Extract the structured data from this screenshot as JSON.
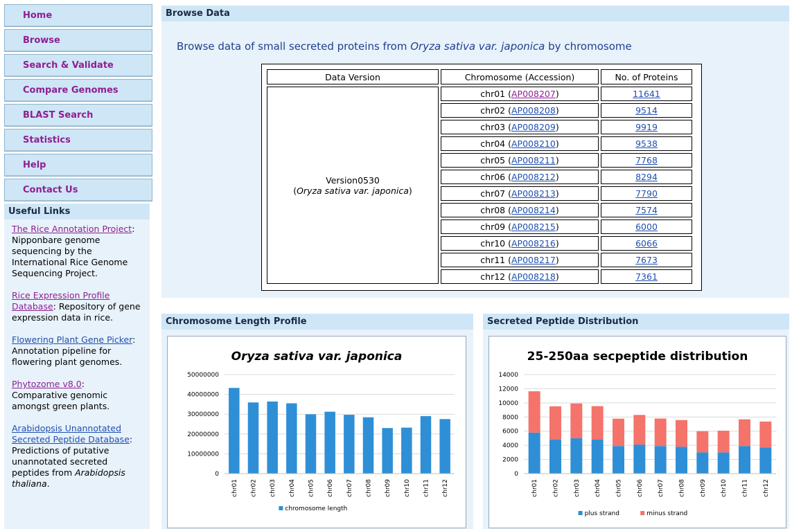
{
  "nav": {
    "items": [
      "Home",
      "Browse",
      "Search & Validate",
      "Compare Genomes",
      "BLAST Search",
      "Statistics",
      "Help",
      "Contact Us"
    ]
  },
  "useful_links": {
    "title": "Useful Links",
    "items": [
      {
        "link": "The Rice Annotation Project",
        "desc": ": Nipponbare genome sequencing by the International Rice Genome Sequencing Project."
      },
      {
        "link": "Rice Expression Profile Database",
        "desc": ": Repository of gene expression data in rice."
      },
      {
        "link": "Flowering Plant Gene Picker",
        "desc": ": Annotation pipeline for flowering plant genomes."
      },
      {
        "link": "Phytozome v8.0",
        "desc": ": Comparative genomic amongst green plants."
      },
      {
        "link": "Arabidopsis Unannotated Secreted Peptide Database",
        "desc": ": Predictions of putative unannotated secreted peptides from ",
        "desc_italic": "Arabidopsis thaliana",
        "desc_end": "."
      }
    ]
  },
  "browse": {
    "title": "Browse Data",
    "desc_pre": "Browse data of small secreted proteins from ",
    "desc_italic": "Oryza sativa var. japonica",
    "desc_post": " by chromosome",
    "headers": [
      "Data Version",
      "Chromosome (Accession)",
      "No. of Proteins"
    ],
    "version_line1": "Version0530",
    "version_italic": "Oryza sativa var. japonica",
    "rows": [
      {
        "chr": "chr01",
        "acc": "AP008207",
        "n": "11641"
      },
      {
        "chr": "chr02",
        "acc": "AP008208",
        "n": "9514"
      },
      {
        "chr": "chr03",
        "acc": "AP008209",
        "n": "9919"
      },
      {
        "chr": "chr04",
        "acc": "AP008210",
        "n": "9538"
      },
      {
        "chr": "chr05",
        "acc": "AP008211",
        "n": "7768"
      },
      {
        "chr": "chr06",
        "acc": "AP008212",
        "n": "8294"
      },
      {
        "chr": "chr07",
        "acc": "AP008213",
        "n": "7790"
      },
      {
        "chr": "chr08",
        "acc": "AP008214",
        "n": "7574"
      },
      {
        "chr": "chr09",
        "acc": "AP008215",
        "n": "6000"
      },
      {
        "chr": "chr10",
        "acc": "AP008216",
        "n": "6066"
      },
      {
        "chr": "chr11",
        "acc": "AP008217",
        "n": "7673"
      },
      {
        "chr": "chr12",
        "acc": "AP008218",
        "n": "7361"
      }
    ]
  },
  "panels": {
    "length_title": "Chromosome Length Profile",
    "peptide_title": "Secreted Peptide Distribution"
  },
  "colors": {
    "bar_blue": "#2e8fd6",
    "bar_red": "#f4736b"
  },
  "chart_data": [
    {
      "type": "bar",
      "title": "Oryza sativa var. japonica",
      "categories": [
        "chr01",
        "chr02",
        "chr03",
        "chr04",
        "chr05",
        "chr06",
        "chr07",
        "chr08",
        "chr09",
        "chr10",
        "chr11",
        "chr12"
      ],
      "series": [
        {
          "name": "chromosome length",
          "values": [
            43270000,
            35940000,
            36410000,
            35500000,
            29960000,
            31250000,
            29700000,
            28440000,
            23010000,
            23210000,
            29020000,
            27530000
          ]
        }
      ],
      "yticks": [
        "0",
        "10000000",
        "20000000",
        "30000000",
        "40000000",
        "50000000"
      ],
      "ylim": [
        0,
        50000000
      ],
      "grid": true,
      "legend": "bottom"
    },
    {
      "type": "bar",
      "stacked": true,
      "title": "25-250aa secpeptide distribution",
      "categories": [
        "chr01",
        "chr02",
        "chr03",
        "chr04",
        "chr05",
        "chr06",
        "chr07",
        "chr08",
        "chr09",
        "chr10",
        "chr11",
        "chr12"
      ],
      "series": [
        {
          "name": "plus strand",
          "values": [
            5800,
            4800,
            5000,
            4800,
            3900,
            4100,
            3900,
            3800,
            3000,
            3000,
            3900,
            3700
          ]
        },
        {
          "name": "minus strand",
          "values": [
            5841,
            4714,
            4919,
            4738,
            3868,
            4194,
            3890,
            3774,
            3000,
            3066,
            3773,
            3661
          ]
        }
      ],
      "yticks": [
        "0",
        "2000",
        "4000",
        "6000",
        "8000",
        "10000",
        "12000",
        "14000"
      ],
      "ylim": [
        0,
        14000
      ],
      "grid": true,
      "legend": "bottom"
    }
  ]
}
